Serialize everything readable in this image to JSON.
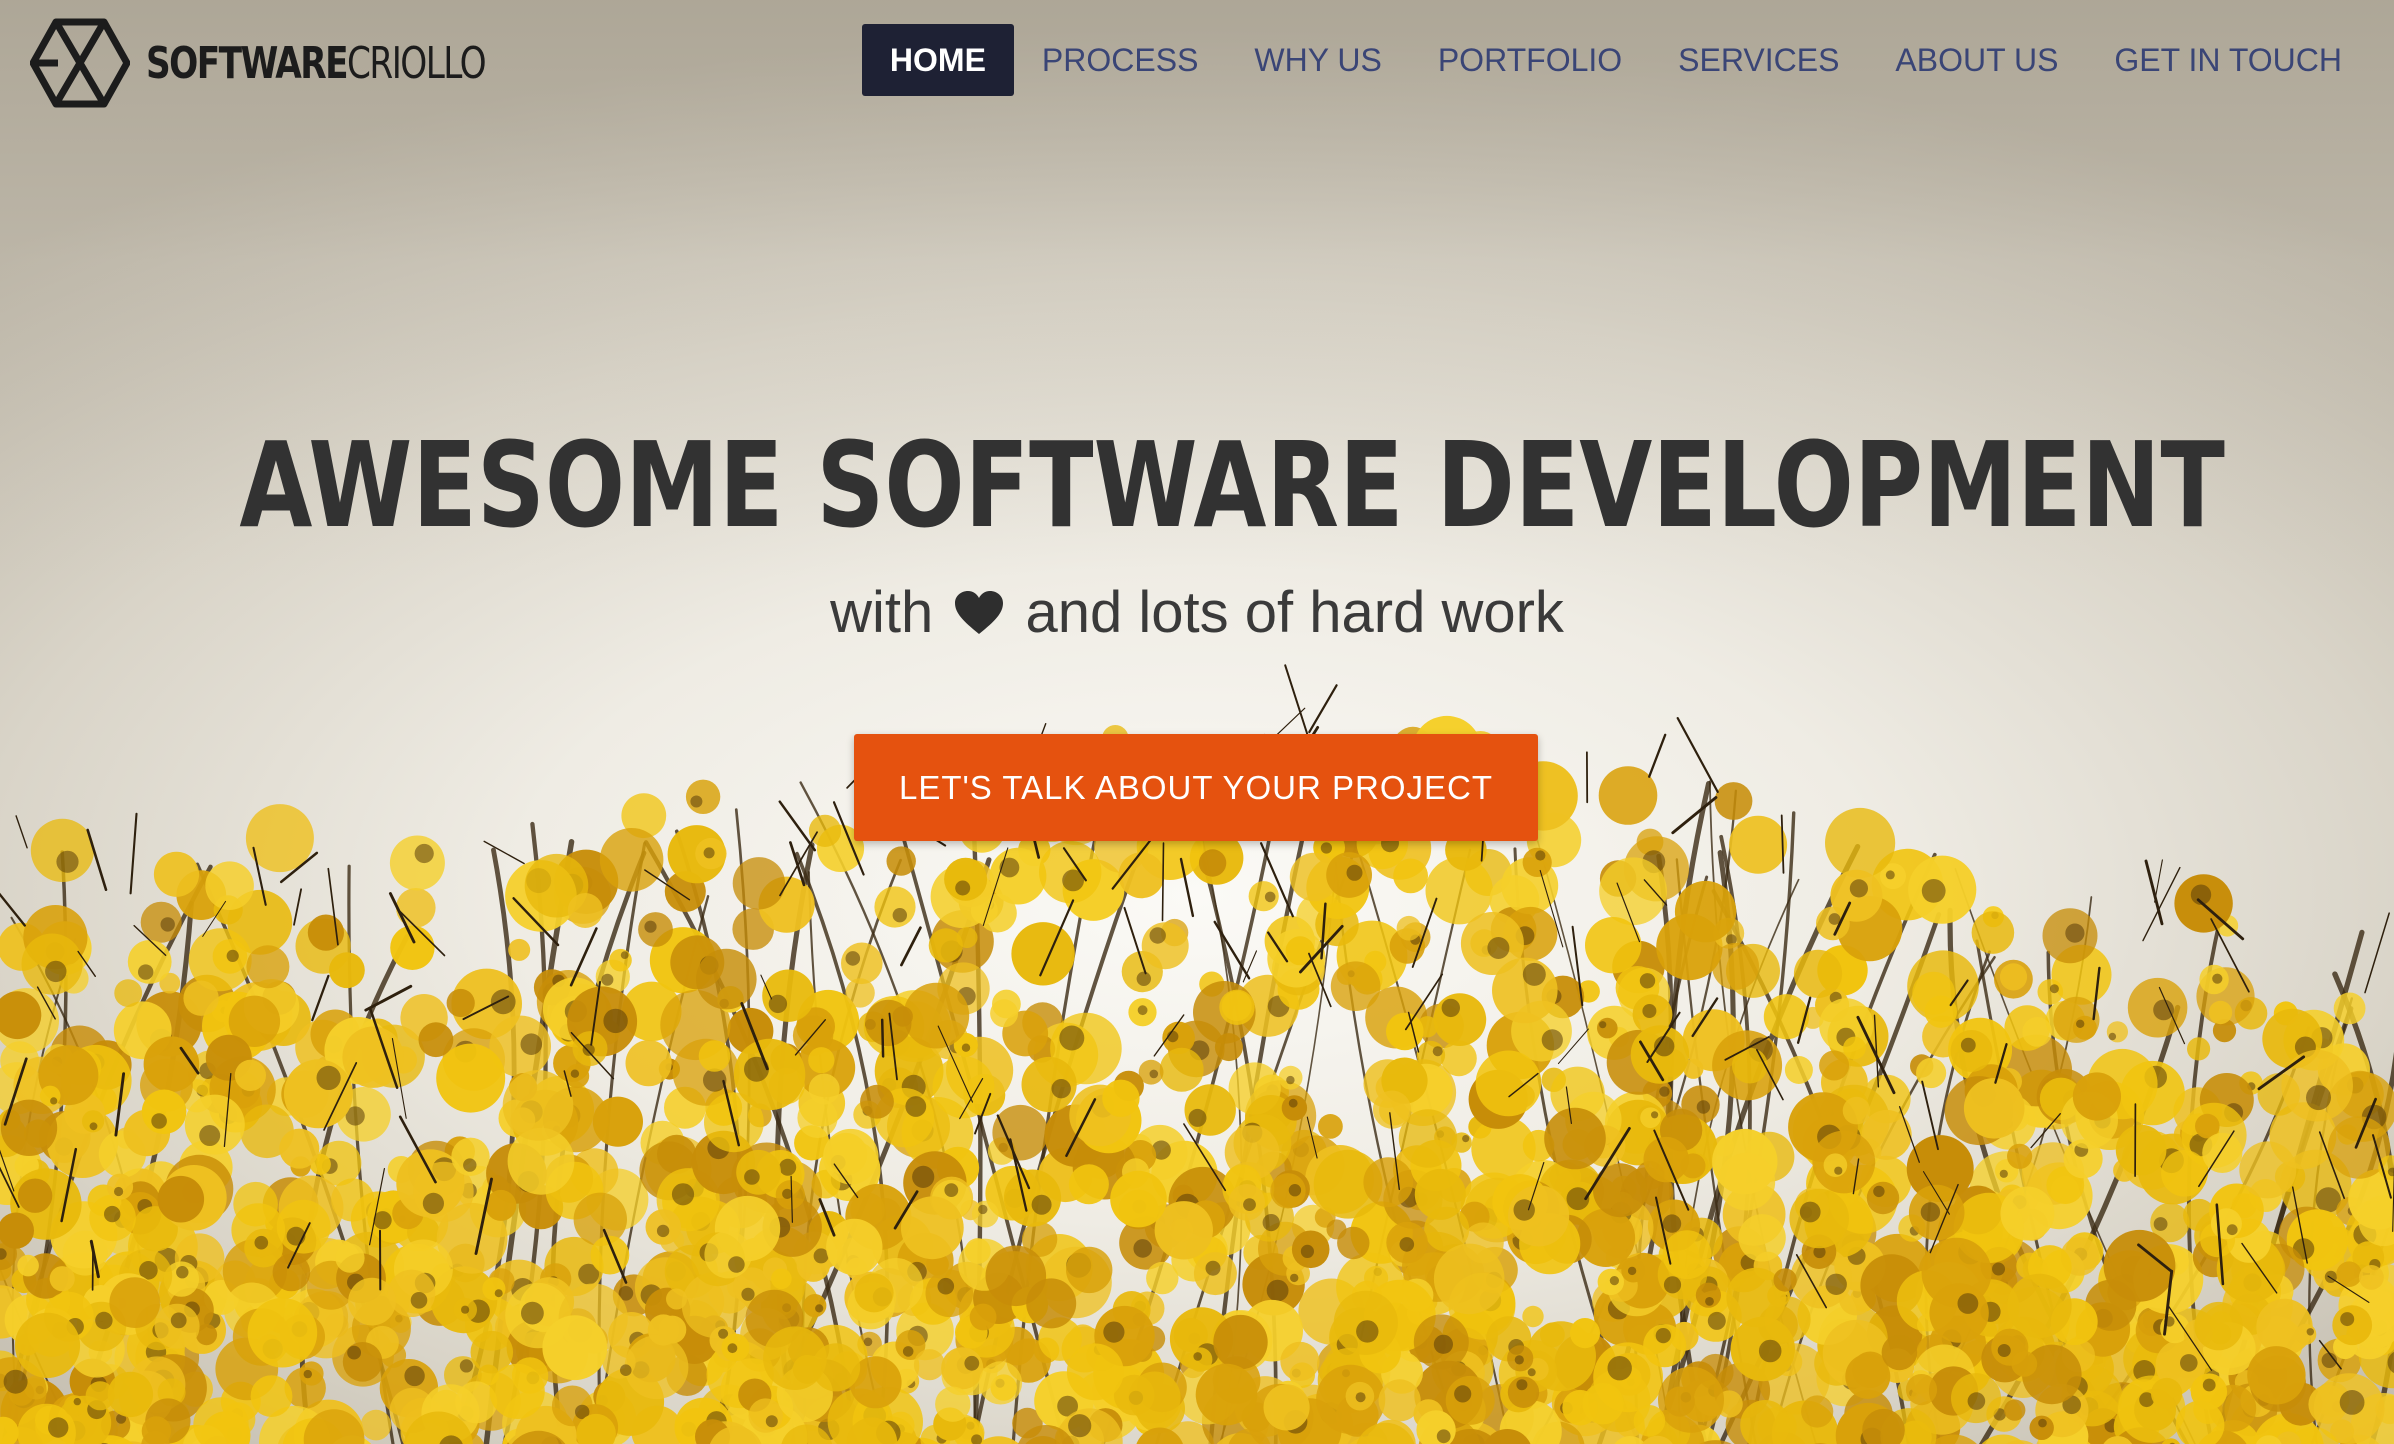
{
  "brand": {
    "name_bold": "SOFTWARE",
    "name_light": "CRIOLLO",
    "logo_icon": "hexagon-cube-logo-icon"
  },
  "nav": {
    "items": [
      {
        "label": "HOME",
        "active": true
      },
      {
        "label": "PROCESS",
        "active": false
      },
      {
        "label": "WHY US",
        "active": false
      },
      {
        "label": "PORTFOLIO",
        "active": false
      },
      {
        "label": "SERVICES",
        "active": false
      },
      {
        "label": "ABOUT US",
        "active": false
      },
      {
        "label": "GET IN TOUCH",
        "active": false
      }
    ]
  },
  "hero": {
    "headline": "AWESOME SOFTWARE DEVELOPMENT",
    "subline_before": "with",
    "subline_icon": "heart-icon",
    "subline_after": "and lots of hard work",
    "cta_label": "LET'S TALK ABOUT YOUR PROJECT",
    "background_image": "yellow flowering tree branches against pale sky"
  },
  "colors": {
    "nav_active_bg": "#1e2134",
    "nav_text": "#3a4576",
    "cta_bg": "#e5520f",
    "headline": "#323232",
    "flower_yellow": "#e8b90c"
  }
}
